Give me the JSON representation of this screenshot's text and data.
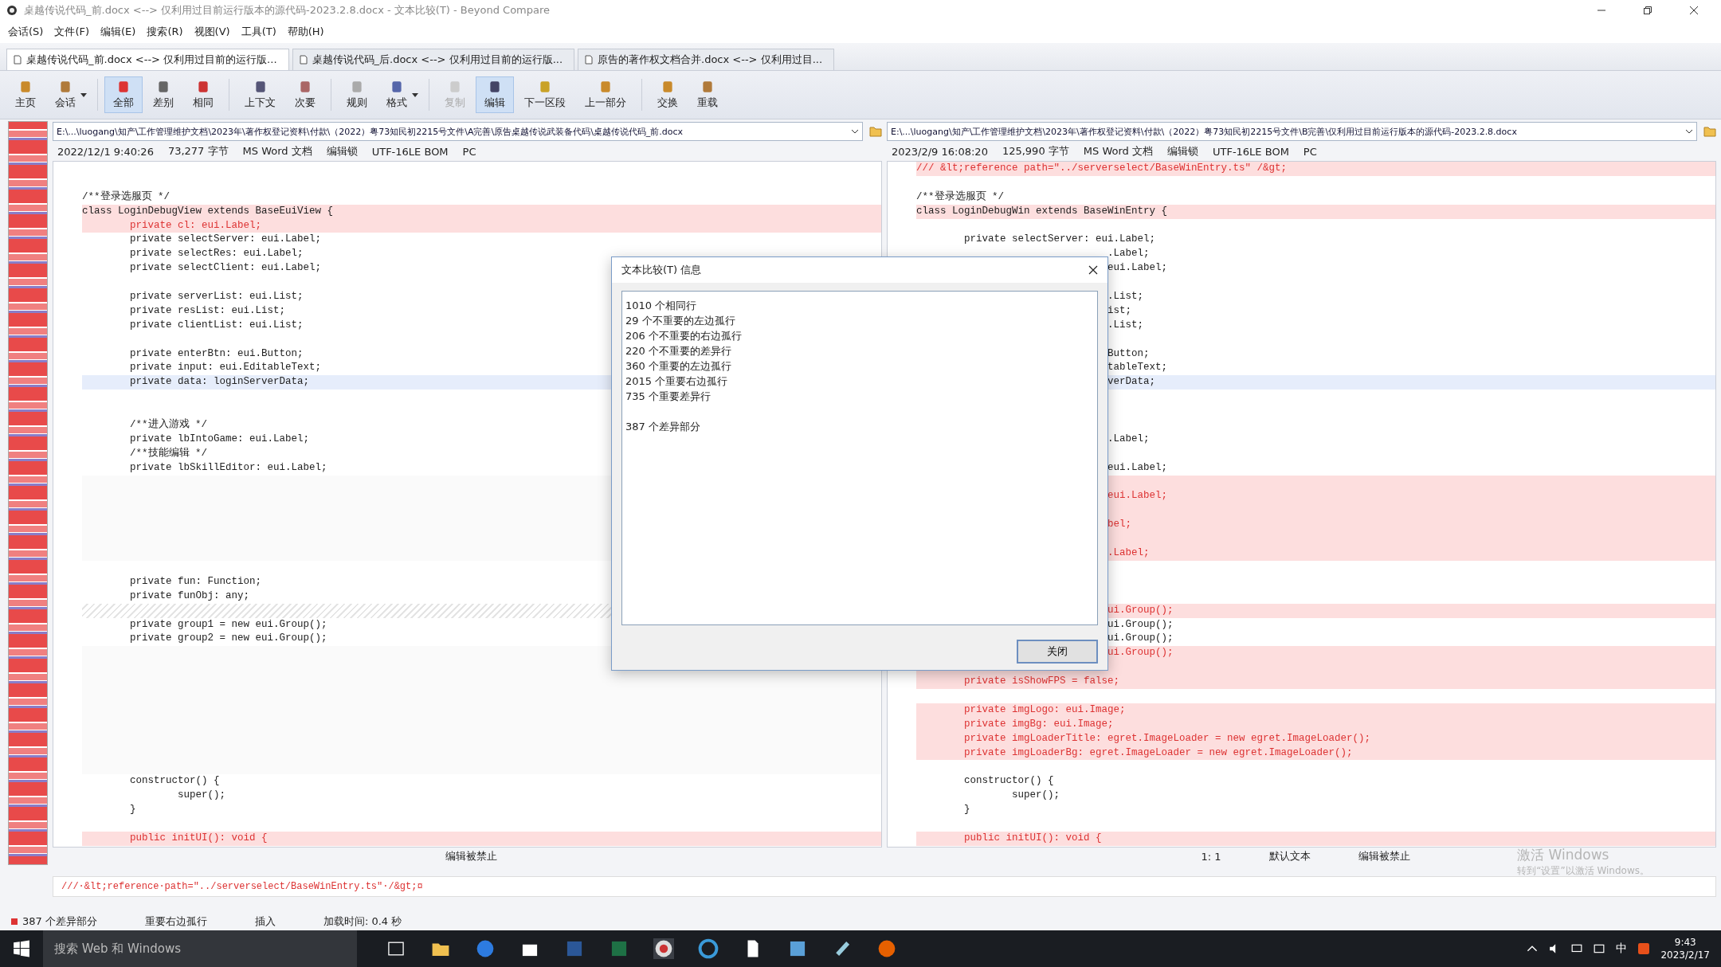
{
  "window": {
    "title": "桌越传说代码_前.docx <--> 仅利用过目前运行版本的源代码-2023.2.8.docx - 文本比较(T) - Beyond Compare"
  },
  "menu": [
    "会话(S)",
    "文件(F)",
    "编辑(E)",
    "搜索(R)",
    "视图(V)",
    "工具(T)",
    "帮助(H)"
  ],
  "tabs": [
    {
      "label": "桌越传说代码_前.docx <--> 仅利用过目前的运行版...",
      "selected": true
    },
    {
      "label": "桌越传说代码_后.docx <--> 仅利用过目前的运行版...",
      "selected": false
    },
    {
      "label": "原告的著作权文档合并.docx <--> 仅利用过目...",
      "selected": false
    }
  ],
  "toolbar": [
    [
      {
        "label": "主页",
        "selected": false,
        "disabled": false,
        "dropdown": false
      },
      {
        "label": "会话",
        "selected": false,
        "disabled": false,
        "dropdown": true
      }
    ],
    [
      {
        "label": "全部",
        "selected": true,
        "disabled": false,
        "dropdown": false
      },
      {
        "label": "差别",
        "selected": false,
        "disabled": false,
        "dropdown": false
      },
      {
        "label": "相同",
        "selected": false,
        "disabled": false,
        "dropdown": false
      }
    ],
    [
      {
        "label": "上下文",
        "selected": false,
        "disabled": false,
        "dropdown": false
      },
      {
        "label": "次要",
        "selected": false,
        "disabled": false,
        "dropdown": false
      }
    ],
    [
      {
        "label": "规则",
        "selected": false,
        "disabled": false,
        "dropdown": false
      },
      {
        "label": "格式",
        "selected": false,
        "disabled": false,
        "dropdown": true
      }
    ],
    [
      {
        "label": "复制",
        "selected": false,
        "disabled": true,
        "dropdown": false
      },
      {
        "label": "编辑",
        "selected": true,
        "disabled": false,
        "dropdown": false
      },
      {
        "label": "下一区段",
        "selected": false,
        "disabled": false,
        "dropdown": false
      },
      {
        "label": "上一部分",
        "selected": false,
        "disabled": false,
        "dropdown": false
      }
    ],
    [
      {
        "label": "交换",
        "selected": false,
        "disabled": false,
        "dropdown": false
      },
      {
        "label": "重载",
        "selected": false,
        "disabled": false,
        "dropdown": false
      }
    ]
  ],
  "panes": [
    {
      "path": "E:\\...\\luogang\\知产\\工作管理维护文档\\2023年\\著作权登记资料\\付款\\（2022）粤73知民初2215号文件\\A完善\\原告桌越传说武装备代码\\桌越传说代码_前.docx",
      "info": [
        "2022/12/1 9:40:26",
        "73,277 字节",
        "MS Word 文档",
        "编辑锁",
        "UTF-16LE BOM",
        "PC"
      ],
      "footer": [
        "编辑被禁止"
      ],
      "rows": [
        {
          "kind": "same",
          "text": ""
        },
        {
          "kind": "same",
          "text": ""
        },
        {
          "kind": "same",
          "text": "/**登录选服页 */"
        },
        {
          "kind": "changed",
          "text": "class LoginDebugView extends BaseEuiView {"
        },
        {
          "kind": "diff",
          "text": "        private cl: eui.Label;"
        },
        {
          "kind": "same",
          "text": "        private selectServer: eui.Label;"
        },
        {
          "kind": "same",
          "text": "        private selectRes: eui.Label;"
        },
        {
          "kind": "same",
          "text": "        private selectClient: eui.Label;"
        },
        {
          "kind": "same",
          "text": ""
        },
        {
          "kind": "same",
          "text": "        private serverList: eui.List;"
        },
        {
          "kind": "same",
          "text": "        private resList: eui.List;"
        },
        {
          "kind": "same",
          "text": "        private clientList: eui.List;"
        },
        {
          "kind": "same",
          "text": ""
        },
        {
          "kind": "same",
          "text": "        private enterBtn: eui.Button;"
        },
        {
          "kind": "same",
          "text": "        private input: eui.EditableText;"
        },
        {
          "kind": "current",
          "text": "        private data: loginServerData;"
        },
        {
          "kind": "same",
          "text": ""
        },
        {
          "kind": "same",
          "text": ""
        },
        {
          "kind": "same",
          "text": "        /**进入游戏 */"
        },
        {
          "kind": "same",
          "text": "        private lbIntoGame: eui.Label;"
        },
        {
          "kind": "same",
          "text": "        /**技能编辑 */"
        },
        {
          "kind": "same",
          "text": "        private lbSkillEditor: eui.Label;"
        },
        {
          "kind": "gap",
          "text": ""
        },
        {
          "kind": "gap",
          "text": ""
        },
        {
          "kind": "gap",
          "text": ""
        },
        {
          "kind": "gap",
          "text": ""
        },
        {
          "kind": "gap",
          "text": ""
        },
        {
          "kind": "gap",
          "text": ""
        },
        {
          "kind": "same",
          "text": ""
        },
        {
          "kind": "same",
          "text": "        private fun: Function;"
        },
        {
          "kind": "same",
          "text": "        private funObj: any;"
        },
        {
          "kind": "hatch",
          "text": ""
        },
        {
          "kind": "same",
          "text": "        private group1 = new eui.Group();"
        },
        {
          "kind": "same",
          "text": "        private group2 = new eui.Group();"
        },
        {
          "kind": "gap",
          "text": ""
        },
        {
          "kind": "gap",
          "text": ""
        },
        {
          "kind": "gap",
          "text": ""
        },
        {
          "kind": "gap",
          "text": ""
        },
        {
          "kind": "gap",
          "text": ""
        },
        {
          "kind": "gap",
          "text": ""
        },
        {
          "kind": "gap",
          "text": ""
        },
        {
          "kind": "gap",
          "text": ""
        },
        {
          "kind": "gap",
          "text": ""
        },
        {
          "kind": "same",
          "text": "        constructor() {"
        },
        {
          "kind": "same",
          "text": "                super();"
        },
        {
          "kind": "same",
          "text": "        }"
        },
        {
          "kind": "same",
          "text": ""
        },
        {
          "kind": "diff",
          "text": "        public initUI(): void {"
        }
      ]
    },
    {
      "path": "E:\\...\\luogang\\知产\\工作管理维护文档\\2023年\\著作权登记资料\\付款\\（2022）粤73知民初2215号文件\\B完善\\仅利用过目前运行版本的源代码-2023.2.8.docx",
      "info": [
        "2023/2/9 16:08:20",
        "125,990 字节",
        "MS Word 文档",
        "编辑锁",
        "UTF-16LE BOM",
        "PC"
      ],
      "footer": [
        "1: 1",
        "默认文本",
        "编辑被禁止"
      ],
      "rows": [
        {
          "kind": "diff",
          "text": "/// &lt;reference path=\"../serverselect/BaseWinEntry.ts\" /&gt;"
        },
        {
          "kind": "same",
          "text": ""
        },
        {
          "kind": "same",
          "text": "/**登录选服页 */"
        },
        {
          "kind": "changed",
          "text": "class LoginDebugWin extends BaseWinEntry {"
        },
        {
          "kind": "same",
          "text": ""
        },
        {
          "kind": "same",
          "text": "        private selectServer: eui.Label;"
        },
        {
          "kind": "same",
          "text": ".Label;",
          "covered": true
        },
        {
          "kind": "same",
          "text": "eui.Label;",
          "covered": true
        },
        {
          "kind": "same",
          "text": ""
        },
        {
          "kind": "same",
          "text": ".List;",
          "covered": true
        },
        {
          "kind": "same",
          "text": "ist;",
          "covered": true
        },
        {
          "kind": "same",
          "text": ".List;",
          "covered": true
        },
        {
          "kind": "same",
          "text": ""
        },
        {
          "kind": "same",
          "text": "Button;",
          "covered": true
        },
        {
          "kind": "same",
          "text": "tableText;",
          "covered": true
        },
        {
          "kind": "current",
          "text": "verData;",
          "covered": true
        },
        {
          "kind": "same",
          "text": ""
        },
        {
          "kind": "same",
          "text": ""
        },
        {
          "kind": "same",
          "text": ""
        },
        {
          "kind": "same",
          "text": ".Label;",
          "covered": true
        },
        {
          "kind": "same",
          "text": ""
        },
        {
          "kind": "same",
          "text": "eui.Label;",
          "covered": true
        },
        {
          "kind": "diff",
          "text": ""
        },
        {
          "kind": "diff",
          "text": "eui.Label;",
          "covered": true
        },
        {
          "kind": "diff",
          "text": ""
        },
        {
          "kind": "diff",
          "text": "bel;",
          "covered": true
        },
        {
          "kind": "diff",
          "text": ""
        },
        {
          "kind": "diff",
          "text": ".Label;",
          "covered": true
        },
        {
          "kind": "same",
          "text": ""
        },
        {
          "kind": "same",
          "text": ""
        },
        {
          "kind": "same",
          "text": ""
        },
        {
          "kind": "diff",
          "text": "ui.Group();",
          "covered": true
        },
        {
          "kind": "same",
          "text": "ui.Group();",
          "covered": true
        },
        {
          "kind": "same",
          "text": "ui.Group();",
          "covered": true
        },
        {
          "kind": "diff",
          "text": "ui.Group();",
          "covered": true
        },
        {
          "kind": "diff",
          "text": ""
        },
        {
          "kind": "diff",
          "text": "        private isShowFPS = false;"
        },
        {
          "kind": "same",
          "text": ""
        },
        {
          "kind": "diff",
          "text": "        private imgLogo: eui.Image;"
        },
        {
          "kind": "diff",
          "text": "        private imgBg: eui.Image;"
        },
        {
          "kind": "diff",
          "text": "        private imgLoaderTitle: egret.ImageLoader = new egret.ImageLoader();"
        },
        {
          "kind": "diff",
          "text": "        private imgLoaderBg: egret.ImageLoader = new egret.ImageLoader();"
        },
        {
          "kind": "same",
          "text": ""
        },
        {
          "kind": "same",
          "text": "        constructor() {"
        },
        {
          "kind": "same",
          "text": "                super();"
        },
        {
          "kind": "same",
          "text": "        }"
        },
        {
          "kind": "same",
          "text": ""
        },
        {
          "kind": "diff",
          "text": "        public initUI(): void {"
        }
      ]
    }
  ],
  "detail_line": "///·&lt;reference·path=\"../serverselect/BaseWinEntry.ts\"·/&gt;¤",
  "dialog": {
    "title": "文本比较(T) 信息",
    "line_groups": [
      [
        "1010 个相同行",
        "29 个不重要的左边孤行",
        "206 个不重要的右边孤行",
        "220 个不重要的差异行",
        "360 个重要的左边孤行",
        "2015 个重要右边孤行",
        "735 个重要差异行"
      ],
      [
        "387 个差异部分"
      ]
    ],
    "button": "关闭"
  },
  "activation_notice": [
    "激活 Windows",
    "转到“设置”以激活 Windows。"
  ],
  "status_bar": [
    "387 个差异部分",
    "重要右边孤行",
    "插入",
    "加载时间: 0.4 秒"
  ],
  "taskbar": {
    "search_placeholder": "搜索 Web 和 Windows",
    "time": "9:43",
    "date": "2023/2/17",
    "ime": "中"
  }
}
